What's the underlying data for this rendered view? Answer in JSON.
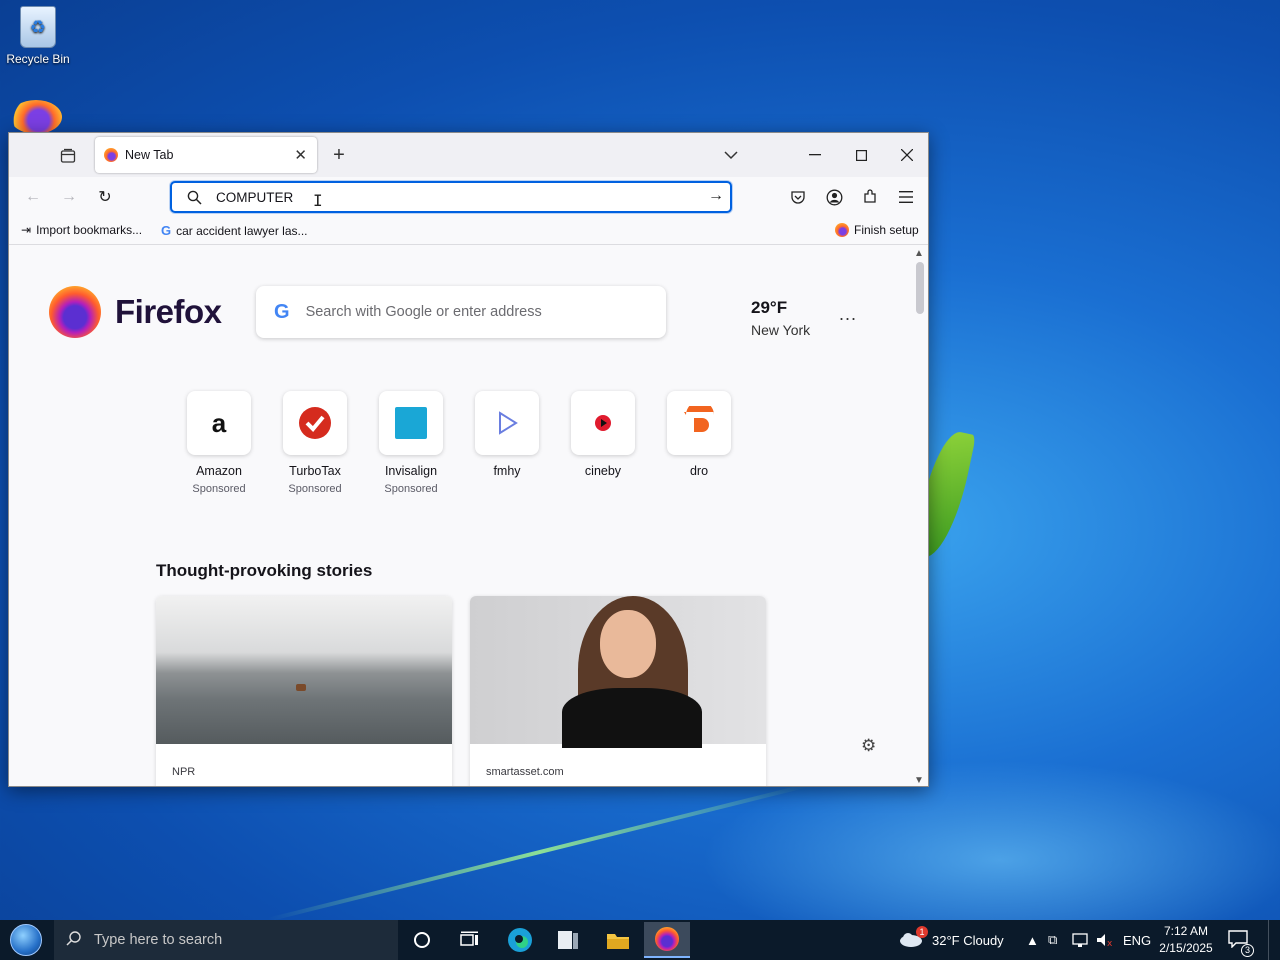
{
  "desktop": {
    "recycle_bin_label": "Recycle Bin"
  },
  "browser": {
    "tab": {
      "title": "New Tab"
    },
    "urlbar": {
      "value": "COMPUTER"
    },
    "bookmarks": [
      {
        "label": "Import bookmarks..."
      },
      {
        "label": "car accident lawyer las..."
      }
    ],
    "finish_setup_label": "Finish setup",
    "newtab": {
      "brand": "Firefox",
      "search_placeholder": "Search with Google or enter address",
      "weather": {
        "temperature": "29°F",
        "city": "New York"
      },
      "more_label": "...",
      "shortcuts": [
        {
          "name": "Amazon",
          "sponsored": "Sponsored",
          "icon": "amazon-icon"
        },
        {
          "name": "TurboTax",
          "sponsored": "Sponsored",
          "icon": "turbotax-icon"
        },
        {
          "name": "Invisalign",
          "sponsored": "Sponsored",
          "icon": "invisalign-icon"
        },
        {
          "name": "fmhy",
          "sponsored": "",
          "icon": "play-icon"
        },
        {
          "name": "cineby",
          "sponsored": "",
          "icon": "cineby-icon"
        },
        {
          "name": "dro",
          "sponsored": "",
          "icon": "dro-icon"
        }
      ],
      "stories_title": "Thought-provoking stories",
      "stories": [
        {
          "source": "NPR"
        },
        {
          "source": "smartasset.com"
        }
      ]
    },
    "colors": {
      "accent": "#0061e0",
      "brand_text": "#20123a"
    }
  },
  "taskbar": {
    "search_placeholder": "Type here to search",
    "weather": "32°F  Cloudy",
    "weather_badge": "1",
    "language": "ENG",
    "time": "7:12 AM",
    "date": "2/15/2025",
    "notifications_count": "3"
  }
}
